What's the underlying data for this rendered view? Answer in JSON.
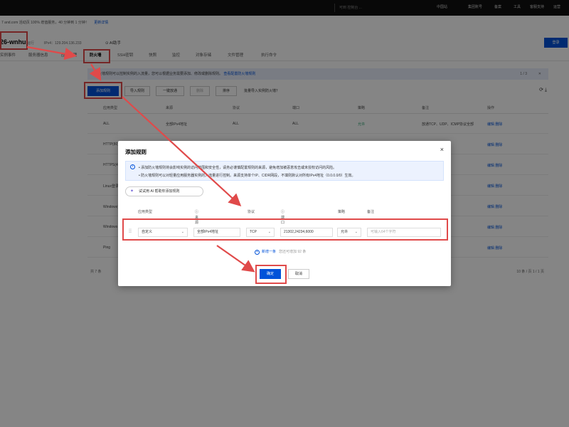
{
  "topbar": {
    "search_placeholder": "可到 控制台 ...",
    "items": [
      "中国站",
      "集团账号",
      "备案",
      "工具",
      "客服支持",
      "运营"
    ]
  },
  "notice": {
    "text": "7 and.com 活动页 100% 增值服务，40 分钟到 1 分钟！",
    "link": "更新详情"
  },
  "instance": {
    "name": "26-wnhu",
    "tag": "运行",
    "ip": "IPv4：129.204.136.233",
    "ai_label": "AI助手"
  },
  "login_button": "登录",
  "tabs": [
    "实例事件",
    "服务器信息",
    "应用管理",
    "防火墙",
    "SSH密钥",
    "快照",
    "监控",
    "对象存储",
    "文件管理",
    "执行命令"
  ],
  "info_strip": {
    "text": "防火墙规则可以控制实例的入流量，您可以根据业务需要添加、修改或删除规则。",
    "link": "查看配置防火墙规则",
    "pager": "1 / 3"
  },
  "toolbar": {
    "add_rule": "添加规则",
    "import": "导入规则",
    "one_click": "一键放通",
    "delete": "删除",
    "sort": "排序",
    "question": "批量导入实例防火墙？"
  },
  "table": {
    "headers": [
      "应用类型",
      "来源",
      "协议",
      "端口",
      "策略",
      "备注",
      "操作"
    ],
    "rows": [
      {
        "type": "ALL",
        "source": "全部IPv4地址",
        "protocol": "ALL",
        "port": "ALL",
        "policy": "允许",
        "note": "放通TCP、UDP、ICMP协议全部",
        "ops": "编辑 删除"
      },
      {
        "type": "HTTP(80)",
        "source": "",
        "protocol": "",
        "port": "",
        "policy": "",
        "note": "",
        "ops": "编辑 删除"
      },
      {
        "type": "HTTPS(443)",
        "source": "",
        "protocol": "",
        "port": "",
        "policy": "",
        "note": "",
        "ops": "编辑 删除"
      },
      {
        "type": "Linux登录",
        "source": "",
        "protocol": "",
        "port": "",
        "policy": "",
        "note": "",
        "ops": "编辑 删除"
      },
      {
        "type": "Windows登录",
        "source": "",
        "protocol": "",
        "port": "",
        "policy": "",
        "note": "服务器",
        "ops": "编辑 删除"
      },
      {
        "type": "Windows",
        "source": "",
        "protocol": "",
        "port": "",
        "policy": "",
        "note": "",
        "ops": "编辑 删除"
      },
      {
        "type": "Ping",
        "source": "",
        "protocol": "",
        "port": "",
        "policy": "",
        "note": "",
        "ops": "编辑 删除"
      }
    ],
    "footer_total": "共 7 条",
    "footer_pager": "10 条 / 页   1 / 1 页"
  },
  "modal": {
    "title": "添加规则",
    "close": "×",
    "info_line1": "添加防火墙规则将会影响实例的访问范围和安全性，请务必谨慎配置规则的来源，避免增加被恶意攻击或未授权访问的风险。",
    "info_line2": "防火墙规则可以对轻量应用服务器实例的入流量进行控制。来源支持单个IP、CIDR网段，不填则默认对所有IPv4地址（0.0.0.0/0）生效。",
    "ai_button": "试试用 AI 帮助你添加规则",
    "headers": [
      "应用类型",
      "来源",
      "协议",
      "端口",
      "策略",
      "备注"
    ],
    "row": {
      "app_type": "自定义",
      "source": "全部IPv4地址",
      "protocol": "TCP",
      "port": "21302,24234,6000",
      "policy": "允许",
      "note_placeholder": "可输入64个字符"
    },
    "add_more": "新增一条",
    "add_more_hint": "您还可增加 92 条",
    "confirm": "确定",
    "cancel": "取消"
  },
  "colors": {
    "accent": "#0052d9",
    "highlight": "#e04a4a",
    "allow": "#2ba471"
  }
}
